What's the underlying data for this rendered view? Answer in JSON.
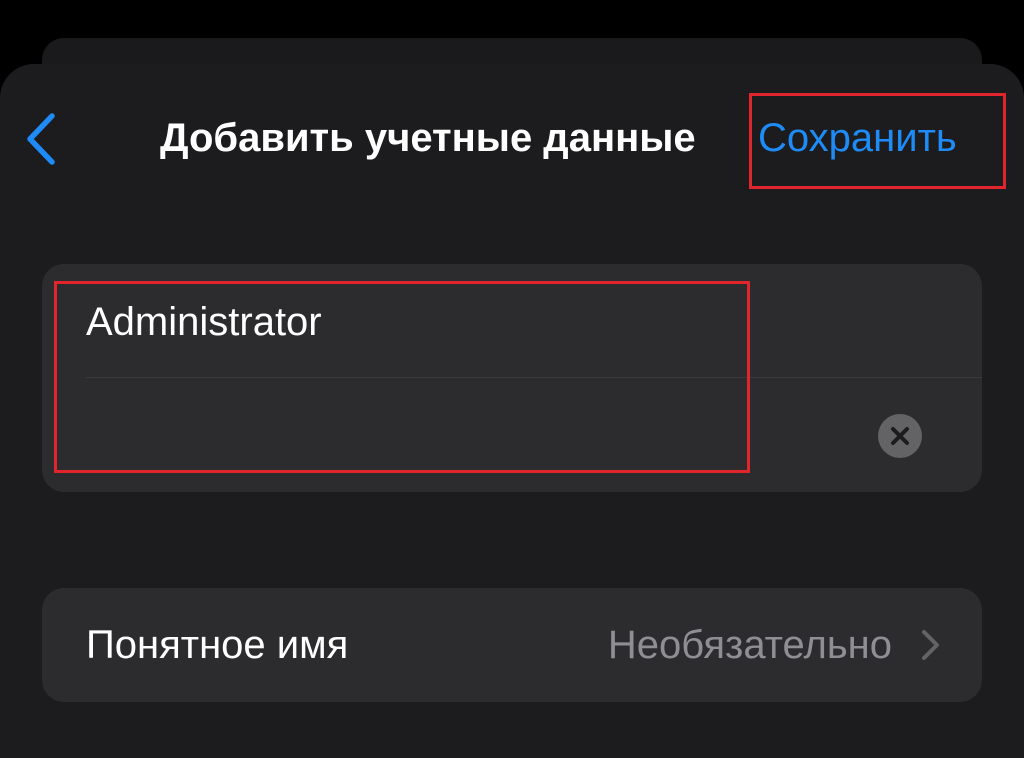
{
  "nav": {
    "back_icon": "chevron-left-icon",
    "title": "Добавить учетные данные",
    "save_label": "Сохранить"
  },
  "credentials": {
    "username_value": "Administrator",
    "password_value": "",
    "clear_icon": "clear-circle-icon"
  },
  "friendly_name": {
    "label": "Понятное имя",
    "value": "Необязательно",
    "chevron_icon": "chevron-right-icon"
  },
  "colors": {
    "accent": "#1e8bf7",
    "background": "#000000",
    "sheet": "#1c1c1e",
    "group": "#2c2c2e",
    "secondary_text": "#8e8e93",
    "highlight": "#e0262c"
  }
}
